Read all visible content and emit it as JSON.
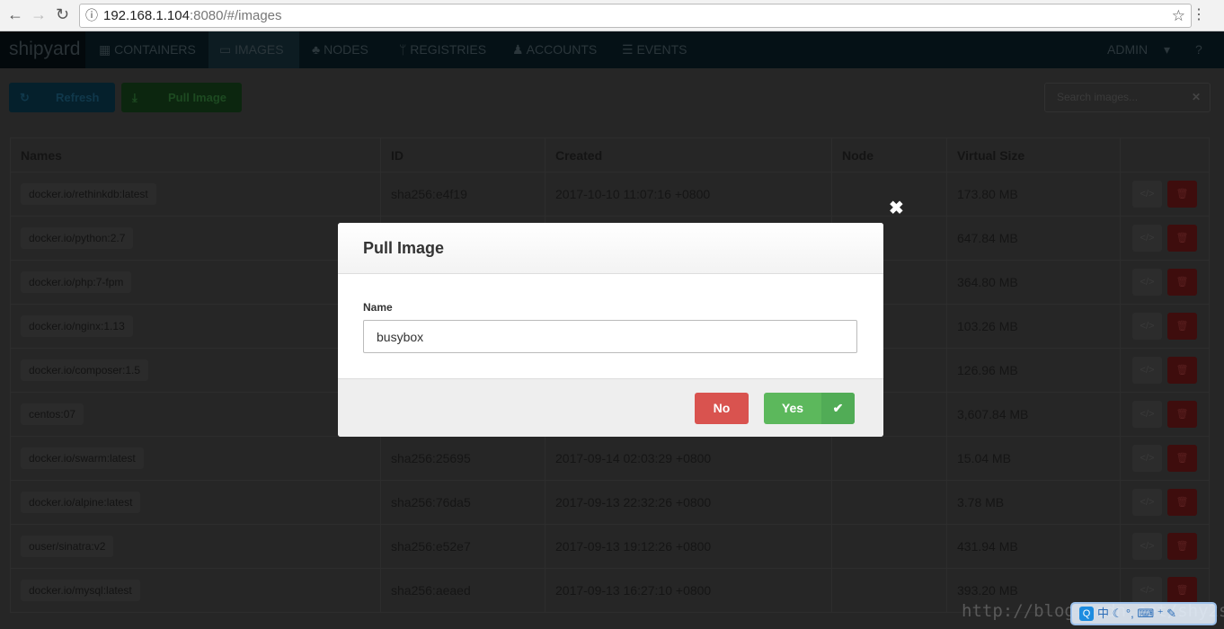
{
  "browser": {
    "url_host": "192.168.1.104",
    "url_rest": ":8080/#/images"
  },
  "nav": {
    "logo": "shipyard",
    "items": [
      {
        "label": "CONTAINERS",
        "icon": "grid-icon",
        "active": false
      },
      {
        "label": "IMAGES",
        "icon": "hdd-icon",
        "active": true
      },
      {
        "label": "NODES",
        "icon": "sitemap-icon",
        "active": false
      },
      {
        "label": "REGISTRIES",
        "icon": "code-fork-icon",
        "active": false
      },
      {
        "label": "ACCOUNTS",
        "icon": "user-icon",
        "active": false
      },
      {
        "label": "EVENTS",
        "icon": "list-icon",
        "active": false
      }
    ],
    "user": "ADMIN"
  },
  "toolbar": {
    "refresh": "Refresh",
    "pull": "Pull Image",
    "search_placeholder": "Search images..."
  },
  "table": {
    "headers": [
      "Names",
      "ID",
      "Created",
      "Node",
      "Virtual Size",
      ""
    ],
    "rows": [
      {
        "name": "docker.io/rethinkdb:latest",
        "id": "sha256:e4f19",
        "created": "2017-10-10 11:07:16 +0800",
        "node": "",
        "size": "173.80 MB"
      },
      {
        "name": "docker.io/python:2.7",
        "id": "",
        "created": "",
        "node": "",
        "size": "647.84 MB"
      },
      {
        "name": "docker.io/php:7-fpm",
        "id": "",
        "created": "",
        "node": "",
        "size": "364.80 MB"
      },
      {
        "name": "docker.io/nginx:1.13",
        "id": "",
        "created": "",
        "node": "",
        "size": "103.26 MB"
      },
      {
        "name": "docker.io/composer:1.5",
        "id": "",
        "created": "",
        "node": "",
        "size": "126.96 MB"
      },
      {
        "name": "centos:07",
        "id": "",
        "created": "",
        "node": "",
        "size": "3,607.84 MB"
      },
      {
        "name": "docker.io/swarm:latest",
        "id": "sha256:25695",
        "created": "2017-09-14 02:03:29 +0800",
        "node": "",
        "size": "15.04 MB"
      },
      {
        "name": "docker.io/alpine:latest",
        "id": "sha256:76da5",
        "created": "2017-09-13 22:32:26 +0800",
        "node": "",
        "size": "3.78 MB"
      },
      {
        "name": "ouser/sinatra:v2",
        "id": "sha256:e52e7",
        "created": "2017-09-13 19:12:26 +0800",
        "node": "",
        "size": "431.94 MB"
      },
      {
        "name": "docker.io/mysql:latest",
        "id": "sha256:aeaed",
        "created": "2017-09-13 16:27:10 +0800",
        "node": "",
        "size": "393.20 MB"
      }
    ]
  },
  "modal": {
    "title": "Pull Image",
    "label": "Name",
    "value": "busybox",
    "no": "No",
    "yes": "Yes"
  },
  "watermark": "http://blog.csdn.net/shy2shy",
  "ime": {
    "label": "中"
  }
}
